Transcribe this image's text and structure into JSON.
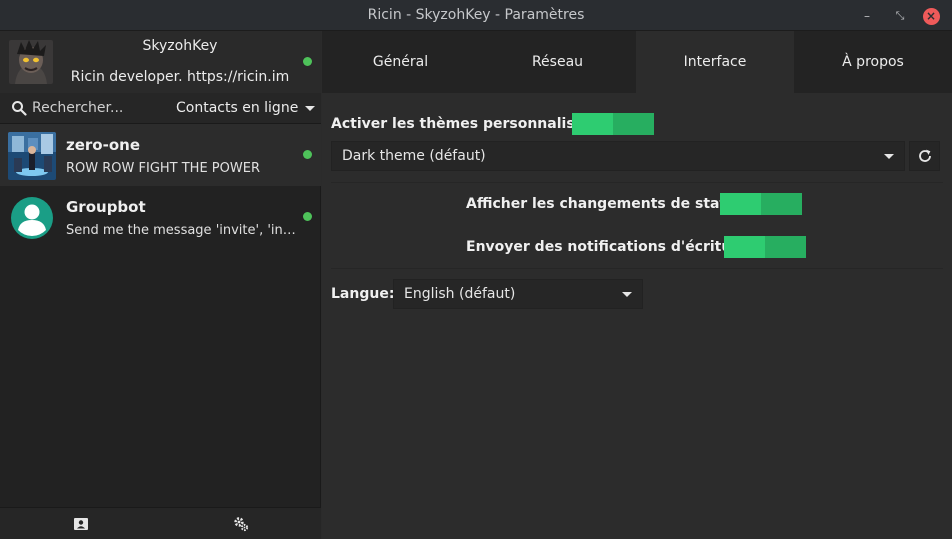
{
  "window": {
    "title": "Ricin - SkyzohKey - Paramètres",
    "minimize_glyph": "–",
    "maximize_glyph": "⤡",
    "close_glyph": "×"
  },
  "profile": {
    "name": "SkyzohKey",
    "status_message": "Ricin developer. https://ricin.im",
    "status_color": "#4ec25a"
  },
  "search": {
    "placeholder": "Rechercher...",
    "filter_label": "Contacts en ligne"
  },
  "contacts": [
    {
      "name": "zero-one",
      "message": "ROW ROW FIGHT THE POWER",
      "status_color": "#4ec25a"
    },
    {
      "name": "Groupbot",
      "message": "Send me the message 'invite', 'info', 'help' or 'join'",
      "status_color": "#4ec25a"
    }
  ],
  "bottom_bar": {
    "icons": [
      "contact-card-icon",
      "settings-gears-icon"
    ]
  },
  "tabs": [
    {
      "label": "Général",
      "active": false
    },
    {
      "label": "Réseau",
      "active": false
    },
    {
      "label": "Interface",
      "active": true
    },
    {
      "label": "À propos",
      "active": false
    }
  ],
  "interface": {
    "custom_themes_label": "Activer les thèmes personnalisés ?",
    "custom_themes_enabled": true,
    "theme_selected": "Dark theme (défaut)",
    "status_changes_label": "Afficher les changements de statut ?",
    "status_changes_enabled": true,
    "typing_notif_label": "Envoyer des notifications d'écriture ?",
    "typing_notif_enabled": true,
    "language_label": "Langue:",
    "language_selected": "English (défaut)"
  },
  "colors": {
    "accent_green": "#2ecc71",
    "accent_green_dark": "#27ae60",
    "online": "#4ec25a",
    "close_button": "#ee5a5a"
  }
}
